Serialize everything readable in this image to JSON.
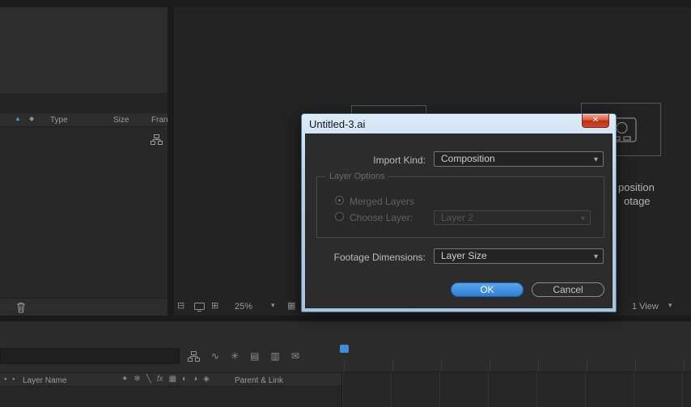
{
  "dialog": {
    "title": "Untitled-3.ai",
    "close_glyph": "✕",
    "import_kind": {
      "label": "Import Kind:",
      "value": "Composition"
    },
    "layer_options": {
      "label": "Layer Options",
      "merged_layers": "Merged Layers",
      "choose_layer": "Choose Layer:",
      "choose_layer_value": "Layer 2"
    },
    "footage_dimensions": {
      "label": "Footage Dimensions:",
      "value": "Layer Size"
    },
    "ok": "OK",
    "cancel": "Cancel"
  },
  "project_panel": {
    "col_type": "Type",
    "col_size": "Size",
    "col_frame": "Fran"
  },
  "viewer": {
    "comp_label": "position",
    "footage_label": "otage",
    "zoom": "25%",
    "view_mode": "1 View"
  },
  "timeline": {
    "layer_name": "Layer Name",
    "parent_link": "Parent & Link"
  },
  "icons": {
    "sort": "▲",
    "tag": "◆",
    "chevron": "▾",
    "panels": "⊟",
    "dual": "⊞",
    "grid": "▦",
    "graph": "∿",
    "star": "✳",
    "layers": "▤",
    "columns": "▥",
    "envelope": "✉",
    "shy": "✦",
    "blend": "❄",
    "quality": "╲",
    "fx": "fx",
    "mblur": "◐",
    "adjust": "◑",
    "cube": "◈",
    "dot": "●"
  },
  "colors": {
    "accent_blue": "#2f7fd6",
    "close_red": "#c9402c"
  }
}
